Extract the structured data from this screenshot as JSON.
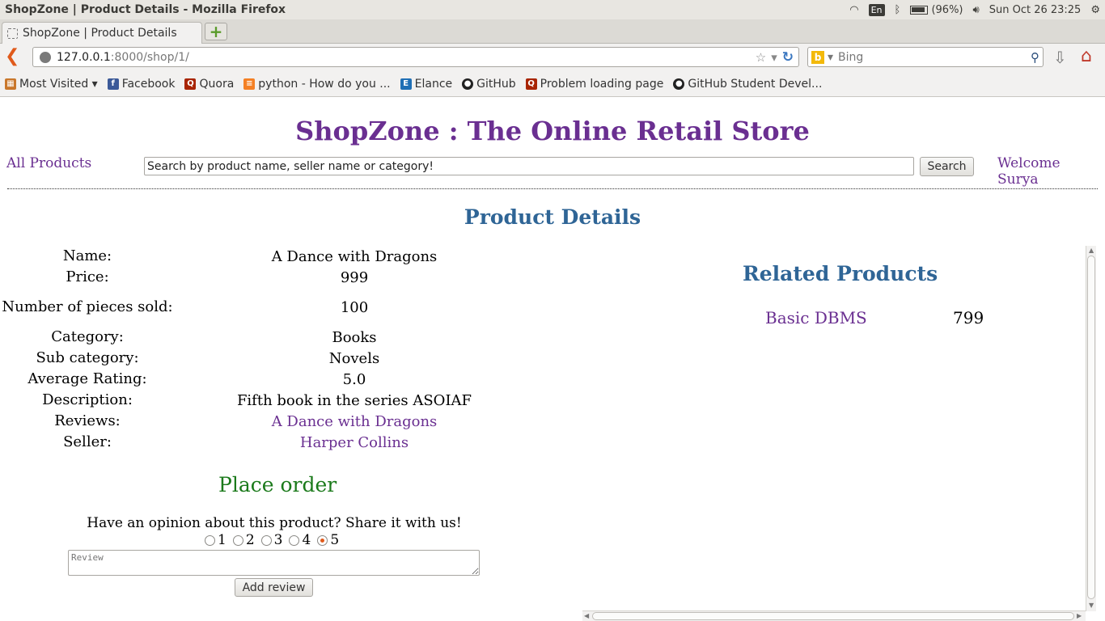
{
  "os": {
    "window_title": "ShopZone | Product Details - Mozilla Firefox",
    "lang": "En",
    "battery": "(96%)",
    "clock": "Sun Oct 26 23:25"
  },
  "browser": {
    "tab_title": "ShopZone | Product Details",
    "url_host": "127.0.0.1",
    "url_rest": ":8000/shop/1/",
    "search_placeholder": "Bing",
    "bookmarks": [
      {
        "label": "Most Visited ▾",
        "icon": "most-visited-icon"
      },
      {
        "label": "Facebook",
        "icon": "facebook-icon"
      },
      {
        "label": "Quora",
        "icon": "quora-icon"
      },
      {
        "label": "python - How do you ...",
        "icon": "stackoverflow-icon"
      },
      {
        "label": "Elance",
        "icon": "elance-icon"
      },
      {
        "label": "GitHub",
        "icon": "github-icon"
      },
      {
        "label": "Problem loading page",
        "icon": "quora-icon"
      },
      {
        "label": "GitHub Student Devel...",
        "icon": "github-icon"
      }
    ]
  },
  "site": {
    "title": "ShopZone : The Online Retail Store",
    "all_products": "All Products",
    "search_value": "Search by product name, seller name or category!",
    "search_button": "Search",
    "welcome": "Welcome Surya"
  },
  "product": {
    "section_title": "Product Details",
    "rows": [
      {
        "label": "Name:",
        "value": "A Dance with Dragons",
        "link": false
      },
      {
        "label": "Price:",
        "value": "999",
        "link": false
      },
      {
        "label": "Number of pieces sold:",
        "value": "100",
        "link": false
      },
      {
        "label": "Category:",
        "value": "Books",
        "link": false
      },
      {
        "label": "Sub category:",
        "value": "Novels",
        "link": false
      },
      {
        "label": "Average Rating:",
        "value": "5.0",
        "link": false
      },
      {
        "label": "Description:",
        "value": "Fifth book in the series ASOIAF",
        "link": false
      },
      {
        "label": "Reviews:",
        "value": "A Dance with Dragons",
        "link": true
      },
      {
        "label": "Seller:",
        "value": "Harper Collins",
        "link": true
      }
    ],
    "place_order": "Place order",
    "opinion": "Have an opinion about this product? Share it with us!",
    "ratings": [
      "1",
      "2",
      "3",
      "4",
      "5"
    ],
    "selected_rating": "5",
    "review_placeholder": "Review",
    "add_review": "Add review"
  },
  "related": {
    "title": "Related Products",
    "items": [
      {
        "name": "Basic DBMS",
        "price": "799"
      }
    ]
  },
  "colors": {
    "purple": "#6a2f91",
    "blue_heading": "#2f6596",
    "green": "#1b7a1b"
  }
}
